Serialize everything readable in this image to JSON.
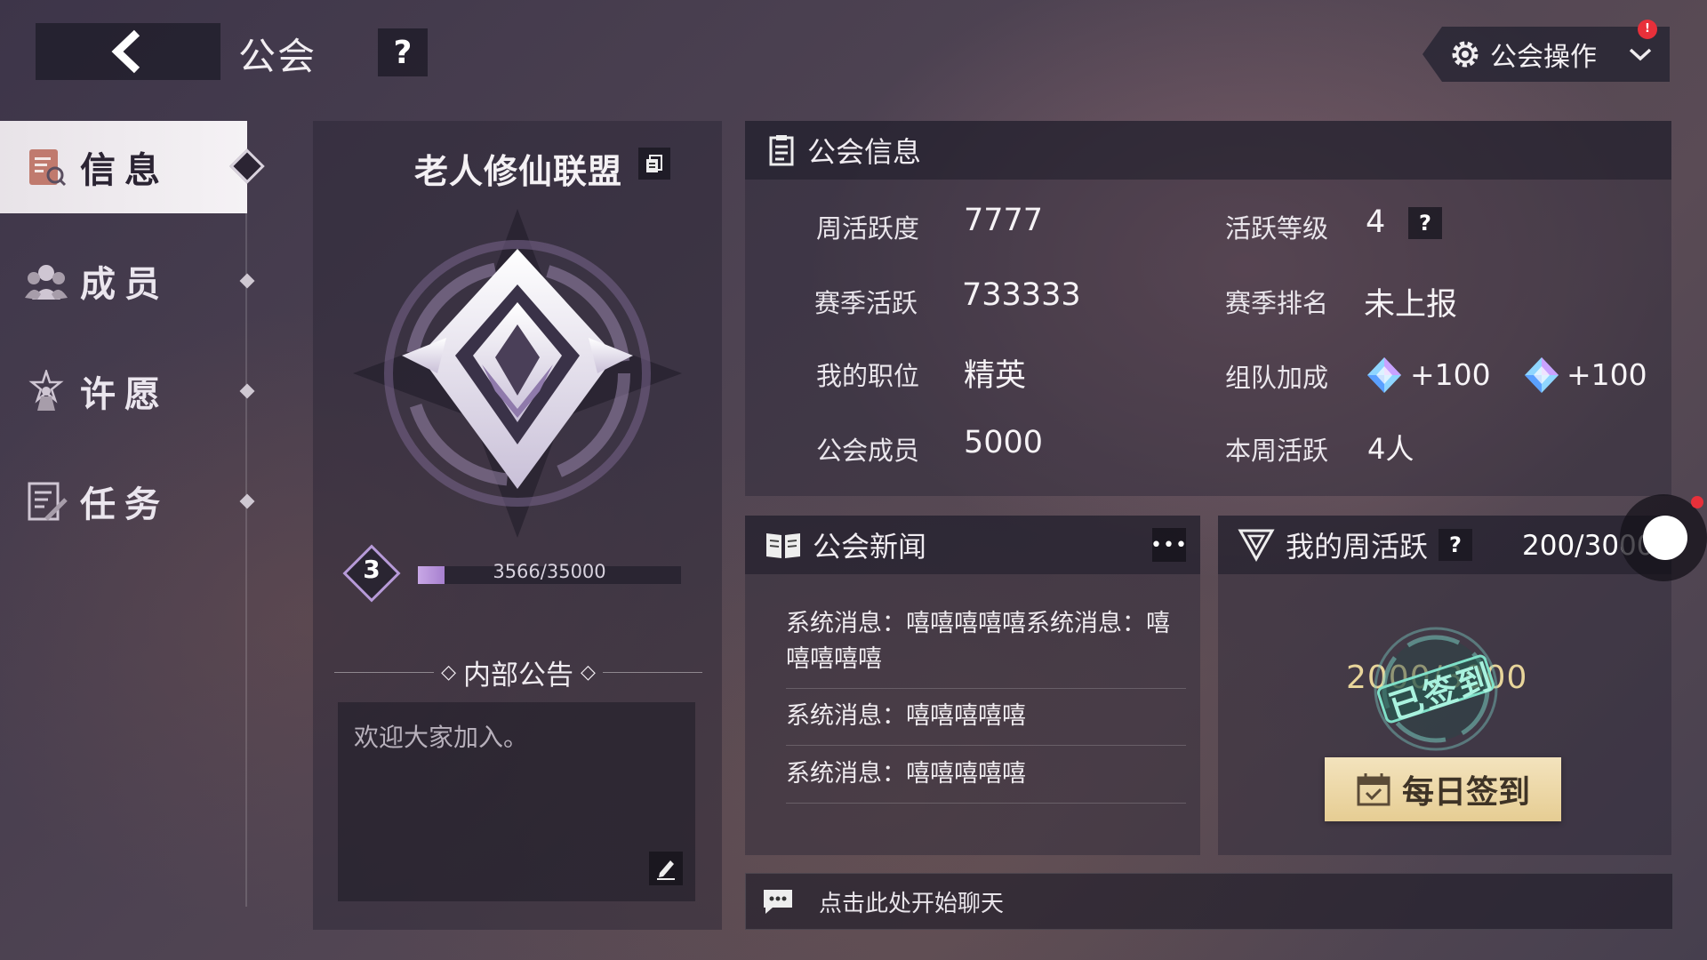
{
  "header": {
    "title": "公会",
    "help_label": "?",
    "guild_ops_label": "公会操作",
    "notif_badge": "!"
  },
  "sidebar": {
    "items": [
      {
        "label": "信息",
        "active": true
      },
      {
        "label": "成员",
        "active": false
      },
      {
        "label": "许愿",
        "active": false
      },
      {
        "label": "任务",
        "active": false
      }
    ]
  },
  "guild": {
    "name": "老人修仙联盟",
    "level": "3",
    "exp_text": "3566/35000",
    "exp_progress": 0.102
  },
  "notice": {
    "title": "内部公告",
    "text": "欢迎大家加入。"
  },
  "info": {
    "title": "公会信息",
    "weekly_activity_label": "周活跃度",
    "weekly_activity_value": "7777",
    "season_activity_label": "赛季活跃",
    "season_activity_value": "733333",
    "my_position_label": "我的职位",
    "my_position_value": "精英",
    "members_label": "公会成员",
    "members_value": "5000",
    "activity_level_label": "活跃等级",
    "activity_level_value": "4",
    "season_rank_label": "赛季排名",
    "season_rank_value": "未上报",
    "team_bonus_label": "组队加成",
    "team_bonus_1": "+100",
    "team_bonus_2": "+100",
    "weekly_active_label": "本周活跃",
    "weekly_active_value": "4人"
  },
  "news": {
    "title": "公会新闻",
    "more": "•••",
    "items": [
      "系统消息：嘻嘻嘻嘻嘻系统消息：嘻嘻嘻嘻嘻",
      "系统消息：嘻嘻嘻嘻嘻",
      "系统消息：嘻嘻嘻嘻嘻"
    ]
  },
  "weekly": {
    "title": "我的周活跃",
    "value": "200/3000",
    "amount": "2000/3000",
    "stamp": "已签到",
    "signin_label": "每日签到"
  },
  "chat": {
    "placeholder": "点击此处开始聊天"
  },
  "colors": {
    "accent_purple": "#b79ad8",
    "gold_button": "#e6cd93",
    "stamp_green": "#7fe0c8",
    "notif_red": "#e8303a"
  }
}
